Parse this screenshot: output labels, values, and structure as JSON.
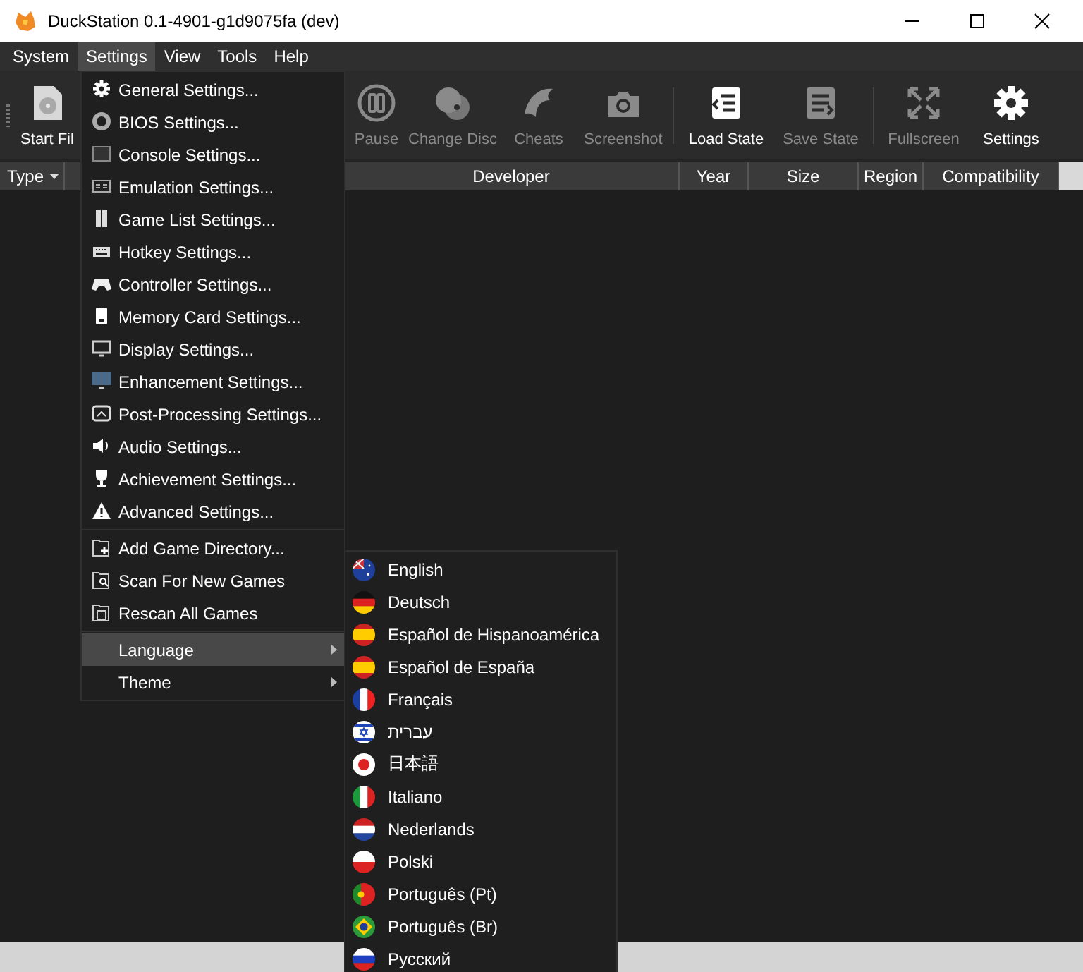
{
  "window": {
    "title": "DuckStation 0.1-4901-g1d9075fa (dev)"
  },
  "menubar": [
    {
      "label": "System",
      "selected": false
    },
    {
      "label": "Settings",
      "selected": true
    },
    {
      "label": "View",
      "selected": false
    },
    {
      "label": "Tools",
      "selected": false
    },
    {
      "label": "Help",
      "selected": false
    }
  ],
  "toolbar": [
    {
      "label": "Start Fil",
      "disabled": false,
      "kind": "button"
    },
    {
      "kind": "hidden"
    },
    {
      "label": "Pause",
      "disabled": true,
      "kind": "button"
    },
    {
      "label": "Change Disc",
      "disabled": true,
      "kind": "button"
    },
    {
      "label": "Cheats",
      "disabled": true,
      "kind": "button"
    },
    {
      "label": "Screenshot",
      "disabled": true,
      "kind": "button"
    },
    {
      "kind": "separator"
    },
    {
      "label": "Load State",
      "disabled": false,
      "kind": "button"
    },
    {
      "label": "Save State",
      "disabled": true,
      "kind": "button"
    },
    {
      "kind": "separator"
    },
    {
      "label": "Fullscreen",
      "disabled": true,
      "kind": "button"
    },
    {
      "label": "Settings",
      "disabled": false,
      "kind": "button"
    }
  ],
  "table": {
    "columns": [
      {
        "label": "Type",
        "sorted": true
      },
      {
        "label": "Developer",
        "sorted": false
      },
      {
        "label": "Year",
        "sorted": false
      },
      {
        "label": "Size",
        "sorted": false
      },
      {
        "label": "Region",
        "sorted": false
      },
      {
        "label": "Compatibility",
        "sorted": false
      }
    ]
  },
  "settings_menu": [
    {
      "kind": "item",
      "label": "General Settings...",
      "selected": false
    },
    {
      "kind": "item",
      "label": "BIOS Settings...",
      "selected": false
    },
    {
      "kind": "item",
      "label": "Console Settings...",
      "selected": false
    },
    {
      "kind": "item",
      "label": "Emulation Settings...",
      "selected": false
    },
    {
      "kind": "item",
      "label": "Game List Settings...",
      "selected": false
    },
    {
      "kind": "item",
      "label": "Hotkey Settings...",
      "selected": false
    },
    {
      "kind": "item",
      "label": "Controller Settings...",
      "selected": false
    },
    {
      "kind": "item",
      "label": "Memory Card Settings...",
      "selected": false
    },
    {
      "kind": "item",
      "label": "Display Settings...",
      "selected": false
    },
    {
      "kind": "item",
      "label": "Enhancement Settings...",
      "selected": false
    },
    {
      "kind": "item",
      "label": "Post-Processing Settings...",
      "selected": false
    },
    {
      "kind": "item",
      "label": "Audio Settings...",
      "selected": false
    },
    {
      "kind": "item",
      "label": "Achievement Settings...",
      "selected": false
    },
    {
      "kind": "item",
      "label": "Advanced Settings...",
      "selected": false
    },
    {
      "kind": "separator"
    },
    {
      "kind": "item",
      "label": "Add Game Directory...",
      "selected": false
    },
    {
      "kind": "item",
      "label": "Scan For New Games",
      "selected": false
    },
    {
      "kind": "item",
      "label": "Rescan All Games",
      "selected": false
    },
    {
      "kind": "separator"
    },
    {
      "kind": "submenu",
      "label": "Language",
      "selected": true
    },
    {
      "kind": "submenu",
      "label": "Theme",
      "selected": false
    }
  ],
  "language_menu": [
    {
      "label": "English"
    },
    {
      "label": "Deutsch"
    },
    {
      "label": "Español de Hispanoamérica"
    },
    {
      "label": "Español de España"
    },
    {
      "label": "Français"
    },
    {
      "label": "עברית"
    },
    {
      "label": "日本語"
    },
    {
      "label": "Italiano"
    },
    {
      "label": "Nederlands"
    },
    {
      "label": "Polski"
    },
    {
      "label": "Português (Pt)"
    },
    {
      "label": "Português (Br)"
    },
    {
      "label": "Русский"
    }
  ]
}
